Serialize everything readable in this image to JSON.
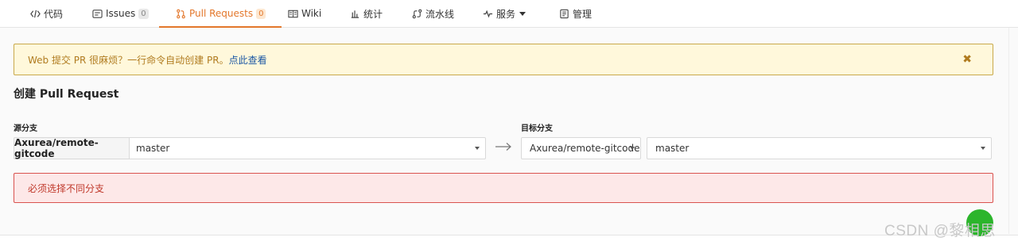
{
  "tabs": [
    {
      "label": "代码",
      "icon": "code-icon"
    },
    {
      "label": "Issues",
      "count": "0",
      "icon": "issues-icon"
    },
    {
      "label": "Pull Requests",
      "count": "0",
      "icon": "pull-request-icon",
      "active": true
    },
    {
      "label": "Wiki",
      "icon": "wiki-icon"
    },
    {
      "label": "统计",
      "icon": "stats-icon"
    },
    {
      "label": "流水线",
      "icon": "pipeline-icon"
    },
    {
      "label": "服务",
      "icon": "service-icon"
    },
    {
      "label": "管理",
      "icon": "manage-icon"
    }
  ],
  "banner": {
    "text": "Web 提交 PR 很麻烦？一行命令自动创建 PR。",
    "link": "点此查看",
    "close": "✖"
  },
  "page_title": "创建 Pull Request",
  "source": {
    "label": "源分支",
    "repo": "Axurea/remote-gitcode",
    "branch": "master"
  },
  "target": {
    "label": "目标分支",
    "repo": "Axurea/remote-gitcode",
    "branch": "master"
  },
  "error": "必须选择不同分支",
  "watermark": "CSDN @黎相思",
  "colors": {
    "accent": "#e3772b",
    "warning_bg": "#fff8db",
    "error_bg": "#fde8e8",
    "error_border": "#d9534f"
  }
}
